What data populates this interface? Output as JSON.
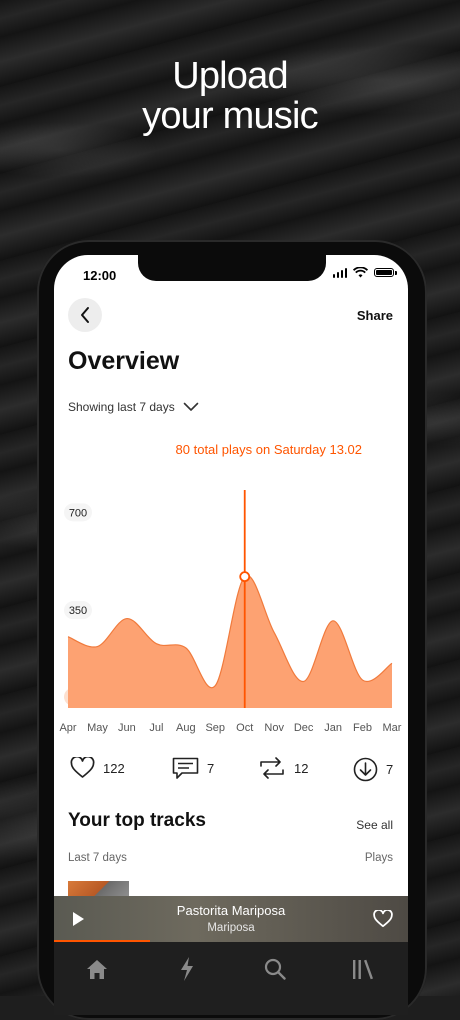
{
  "headline": {
    "line1": "Upload",
    "line2": "your music"
  },
  "status_bar": {
    "time": "12:00"
  },
  "header": {
    "back_icon": "chevron-left-icon",
    "share_label": "Share"
  },
  "page_title": "Overview",
  "filter": {
    "label": "Showing last 7 days",
    "icon": "chevron-down-icon"
  },
  "highlight": "80 total plays on Saturday 13.02",
  "chart_data": {
    "type": "area",
    "x": [
      "Apr",
      "May",
      "Jun",
      "Jul",
      "Aug",
      "Sep",
      "Oct",
      "Nov",
      "Dec",
      "Jan",
      "Feb",
      "Mar"
    ],
    "y_ticks": [
      "700",
      "350",
      "40"
    ],
    "series": [
      {
        "values": [
          255,
          220,
          320,
          230,
          215,
          80,
          470,
          270,
          95,
          312,
          100,
          160
        ]
      }
    ],
    "selected_index": 6,
    "ylim": [
      0,
      780
    ],
    "color": "#fda272",
    "line_color": "#ff5500"
  },
  "stats": {
    "likes": {
      "icon": "heart-icon",
      "value": "122"
    },
    "comments": {
      "icon": "comment-icon",
      "value": "7"
    },
    "reposts": {
      "icon": "repost-icon",
      "value": "12"
    },
    "downloads": {
      "icon": "download-icon",
      "value": "7"
    }
  },
  "top_tracks": {
    "title": "Your top tracks",
    "see_all": "See all",
    "period": "Last 7 days",
    "column": "Plays"
  },
  "player": {
    "title": "Pastorita Mariposa",
    "artist": "Mariposa",
    "play_icon": "play-icon",
    "like_icon": "heart-icon",
    "progress": 0.27
  },
  "tabbar": {
    "items": [
      "home-icon",
      "lightning-icon",
      "search-icon",
      "library-icon"
    ]
  }
}
